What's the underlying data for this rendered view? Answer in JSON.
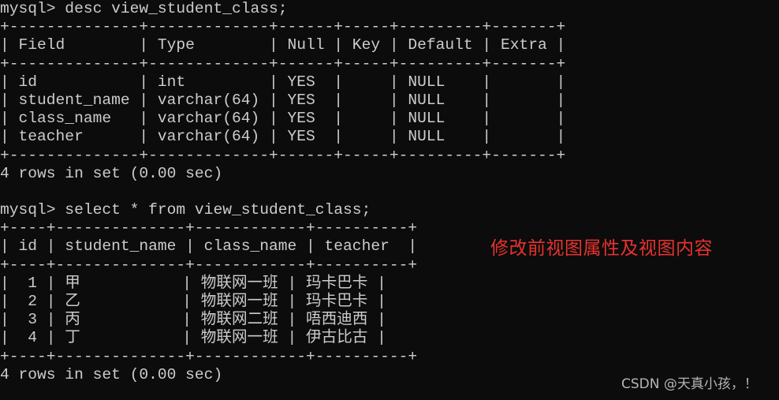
{
  "terminal": {
    "prompt": "mysql> ",
    "commands": [
      "desc view_student_class;",
      "select * from view_student_class;"
    ],
    "desc_table": {
      "columns": [
        "Field",
        "Type",
        "Null",
        "Key",
        "Default",
        "Extra"
      ],
      "rows": [
        [
          "id",
          "int",
          "YES",
          "",
          "NULL",
          ""
        ],
        [
          "student_name",
          "varchar(64)",
          "YES",
          "",
          "NULL",
          ""
        ],
        [
          "class_name",
          "varchar(64)",
          "YES",
          "",
          "NULL",
          ""
        ],
        [
          "teacher",
          "varchar(64)",
          "YES",
          "",
          "NULL",
          ""
        ]
      ],
      "status": "4 rows in set (0.00 sec)"
    },
    "select_table": {
      "columns": [
        "id",
        "student_name",
        "class_name",
        "teacher"
      ],
      "rows": [
        [
          "1",
          "甲",
          "物联网一班",
          "玛卡巴卡"
        ],
        [
          "2",
          "乙",
          "物联网一班",
          "玛卡巴卡"
        ],
        [
          "3",
          "丙",
          "物联网二班",
          "唔西迪西"
        ],
        [
          "4",
          "丁",
          "物联网一班",
          "伊古比古"
        ]
      ],
      "status": "4 rows in set (0.00 sec)"
    }
  },
  "annotation": {
    "text": "修改前视图属性及视图内容",
    "color": "#e8322e"
  },
  "watermark": {
    "text": "CSDN @天真小孩，！"
  }
}
